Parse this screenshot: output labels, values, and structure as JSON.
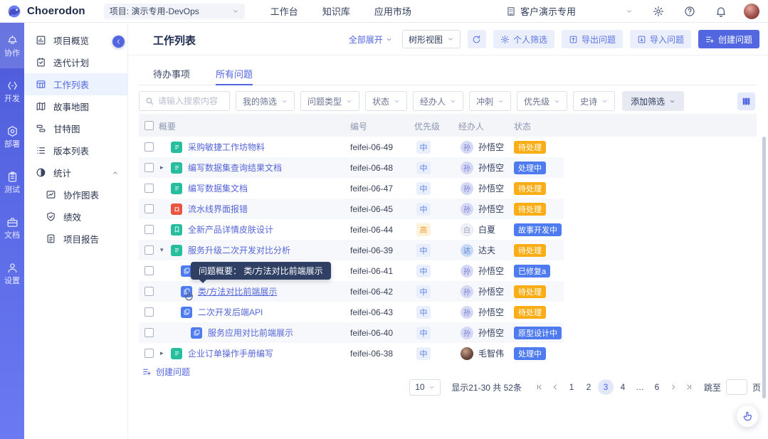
{
  "topbar": {
    "brand": "Choerodon",
    "project_select": "项目: 演示专用-DevOps",
    "menus": [
      "工作台",
      "知识库",
      "应用市场"
    ],
    "org_label": "客户演示专用"
  },
  "primary_nav": [
    {
      "label": "协作",
      "icon": "collab-icon",
      "active": true
    },
    {
      "label": "开发",
      "icon": "dev-icon",
      "active": false
    },
    {
      "label": "部署",
      "icon": "deploy-icon",
      "active": false
    },
    {
      "label": "测试",
      "icon": "test-icon",
      "active": false
    },
    {
      "label": "文档",
      "icon": "docs-icon",
      "active": false
    },
    {
      "label": "设置",
      "icon": "settings-icon",
      "active": false
    }
  ],
  "secondary_nav": [
    {
      "label": "项目概览",
      "icon": "overview-icon",
      "active": false
    },
    {
      "label": "迭代计划",
      "icon": "sprint-icon",
      "active": false
    },
    {
      "label": "工作列表",
      "icon": "worklist-icon",
      "active": true
    },
    {
      "label": "故事地图",
      "icon": "storymap-icon",
      "active": false
    },
    {
      "label": "甘特图",
      "icon": "gantt-icon",
      "active": false
    },
    {
      "label": "版本列表",
      "icon": "versions-icon",
      "active": false
    },
    {
      "label": "统计",
      "icon": "stats-icon",
      "active": false,
      "expanded": true,
      "children": [
        {
          "label": "协作图表",
          "icon": "chart-icon"
        },
        {
          "label": "绩效",
          "icon": "performance-icon"
        },
        {
          "label": "项目报告",
          "icon": "report-icon"
        }
      ]
    }
  ],
  "page": {
    "title": "工作列表",
    "expand_all": "全部展开",
    "view_mode": "树形视图",
    "personal_filter": "个人筛选",
    "export_label": "导出问题",
    "import_label": "导入问题",
    "create_label": "创建问题"
  },
  "tabs": [
    {
      "label": "待办事项",
      "active": false
    },
    {
      "label": "所有问题",
      "active": true
    }
  ],
  "filters": {
    "search_placeholder": "请输入搜索内容",
    "dropdowns": [
      "我的筛选",
      "问题类型",
      "状态",
      "经办人",
      "冲刺",
      "优先级",
      "史诗"
    ],
    "add_filter": "添加筛选"
  },
  "table": {
    "columns": [
      "概要",
      "编号",
      "优先级",
      "经办人",
      "状态"
    ],
    "rows": [
      {
        "type": "task",
        "expand": "none",
        "indent": 0,
        "summary": "采购敏捷工作坊物料",
        "code": "feifei-06-49",
        "priority": "中",
        "priority_level": "medium",
        "assignee": "孙悟空",
        "avatar_text": "孙",
        "avatar_style": "purple",
        "status": "待处理",
        "status_color": "orange",
        "striped": false
      },
      {
        "type": "task",
        "expand": "collapsed",
        "indent": 0,
        "summary": "编写数据集查询结果文档",
        "code": "feifei-06-48",
        "priority": "中",
        "priority_level": "medium",
        "assignee": "孙悟空",
        "avatar_text": "孙",
        "avatar_style": "purple",
        "status": "处理中",
        "status_color": "blue",
        "striped": true
      },
      {
        "type": "task",
        "expand": "none",
        "indent": 0,
        "summary": "编写数据集文档",
        "code": "feifei-06-47",
        "priority": "中",
        "priority_level": "medium",
        "assignee": "孙悟空",
        "avatar_text": "孙",
        "avatar_style": "purple",
        "status": "待处理",
        "status_color": "orange",
        "striped": false
      },
      {
        "type": "bug",
        "expand": "none",
        "indent": 0,
        "summary": "流水线界面报错",
        "code": "feifei-06-45",
        "priority": "中",
        "priority_level": "medium",
        "assignee": "孙悟空",
        "avatar_text": "孙",
        "avatar_style": "purple",
        "status": "待处理",
        "status_color": "orange",
        "striped": true
      },
      {
        "type": "story",
        "expand": "none",
        "indent": 0,
        "summary": "全新产品详情皮肤设计",
        "code": "feifei-06-44",
        "priority": "高",
        "priority_level": "high",
        "assignee": "白夏",
        "avatar_text": "白",
        "avatar_style": "light",
        "status": "故事开发中",
        "status_color": "blue",
        "striped": false
      },
      {
        "type": "task",
        "expand": "expanded",
        "indent": 0,
        "summary": "服务升级二次开发对比分析",
        "code": "feifei-06-39",
        "priority": "中",
        "priority_level": "medium",
        "assignee": "达夫",
        "avatar_text": "达",
        "avatar_style": "blue",
        "status": "待处理",
        "status_color": "orange",
        "striped": true
      },
      {
        "type": "subtask",
        "expand": "none",
        "indent": 1,
        "summary": "",
        "summary_covered_by_tooltip": true,
        "code": "feifei-06-41",
        "priority": "中",
        "priority_level": "medium",
        "assignee": "孙悟空",
        "avatar_text": "孙",
        "avatar_style": "purple",
        "status": "已修复a",
        "status_color": "blue",
        "striped": false
      },
      {
        "type": "subtask",
        "expand": "none",
        "indent": 1,
        "summary": "类/方法对比前端展示",
        "code": "feifei-06-42",
        "priority": "中",
        "priority_level": "medium",
        "assignee": "孙悟空",
        "avatar_text": "孙",
        "avatar_style": "purple",
        "status": "待处理",
        "status_color": "orange",
        "striped": true,
        "hovered": true
      },
      {
        "type": "subtask",
        "expand": "none",
        "indent": 1,
        "summary": "二次开发后端API",
        "code": "feifei-06-43",
        "priority": "中",
        "priority_level": "medium",
        "assignee": "孙悟空",
        "avatar_text": "孙",
        "avatar_style": "purple",
        "status": "待处理",
        "status_color": "orange",
        "striped": false
      },
      {
        "type": "subtask",
        "expand": "none",
        "indent": 2,
        "summary": "服务应用对比前端展示",
        "code": "feifei-06-40",
        "priority": "中",
        "priority_level": "medium",
        "assignee": "孙悟空",
        "avatar_text": "孙",
        "avatar_style": "purple",
        "status": "原型设计中",
        "status_color": "blue",
        "striped": true
      },
      {
        "type": "task",
        "expand": "collapsed",
        "indent": 0,
        "summary": "企业订单操作手册编写",
        "code": "feifei-06-38",
        "priority": "中",
        "priority_level": "medium",
        "assignee": "毛智伟",
        "avatar_text": "",
        "avatar_style": "photo",
        "status": "处理中",
        "status_color": "blue",
        "striped": false
      }
    ]
  },
  "tooltip": {
    "text": "问题概要： 类/方法对比前端展示"
  },
  "footer": {
    "create_label": "创建问题",
    "page_size": "10",
    "summary": "显示21-30 共 52条",
    "pages": [
      "1",
      "2",
      "3",
      "4",
      "...",
      "6"
    ],
    "active_page": "3",
    "jump_label": "跳至",
    "page_unit": "页"
  },
  "colors": {
    "primary": "#5266E0",
    "status_orange": "#FAAD14",
    "status_blue": "#4E7CF0",
    "task_green": "#27BE9D",
    "bug_red": "#EA5541",
    "subtask_blue": "#4E7CF0"
  }
}
